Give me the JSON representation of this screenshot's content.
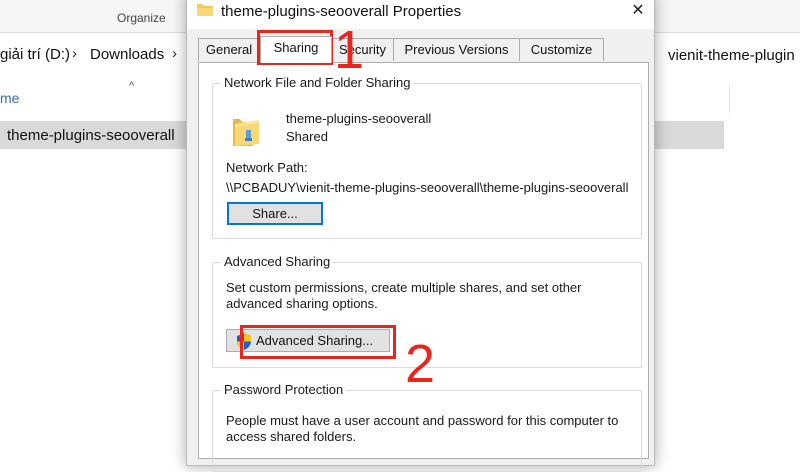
{
  "explorer": {
    "toolbar_label": "Organize",
    "breadcrumb": [
      "giải trí (D:)",
      "Downloads"
    ],
    "right_path": "vienit-theme-plugin",
    "column_header": "me",
    "selected_file": "theme-plugins-seooverall"
  },
  "dialog": {
    "title": "theme-plugins-seooverall Properties",
    "tabs": [
      {
        "label": "General"
      },
      {
        "label": "Sharing"
      },
      {
        "label": "Security"
      },
      {
        "label": "Previous Versions"
      },
      {
        "label": "Customize"
      }
    ],
    "network_sharing": {
      "group_title": "Network File and Folder Sharing",
      "share_name": "theme-plugins-seooverall",
      "share_status": "Shared",
      "network_path_label": "Network Path:",
      "network_path_value": "\\\\PCBADUY\\vienit-theme-plugins-seooverall\\theme-plugins-seooverall",
      "share_button_label": "Share..."
    },
    "advanced_sharing": {
      "group_title": "Advanced Sharing",
      "description": "Set custom permissions, create multiple shares, and set other advanced sharing options.",
      "button_label": "Advanced Sharing..."
    },
    "password_protection": {
      "group_title": "Password Protection",
      "description": "People must have a user account and password for this computer to access shared folders."
    }
  },
  "annotations": {
    "step1": "1",
    "step2": "2",
    "color": "#e8261d"
  },
  "colors": {
    "dialog_bg": "#f0f0f0",
    "panel_bg": "#ffffff",
    "button_bg": "#e1e1e1",
    "focus_blue": "#0078d7",
    "selected_row": "#d9d9d9"
  }
}
